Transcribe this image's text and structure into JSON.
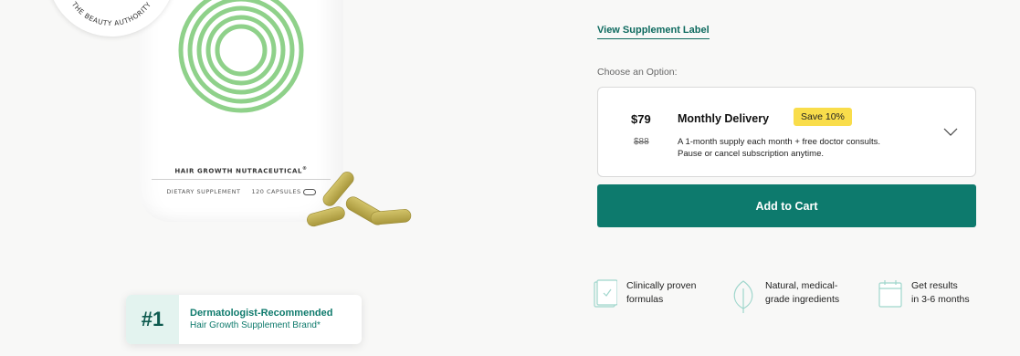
{
  "product": {
    "bottle_name": "HAIR GROWTH NUTRACEUTICAL",
    "bottle_name_mark": "®",
    "bottle_type": "DIETARY SUPPLEMENT",
    "bottle_count": "120 CAPSULES",
    "seal_text": "THE BEAUTY AUTHORITY",
    "ring_color": "#8fd18a",
    "capsule_color": "#bfae4d"
  },
  "badge": {
    "number": "#1",
    "title": "Dermatologist-Recommended",
    "subtitle": "Hair Growth Supplement Brand*"
  },
  "purchase": {
    "supplement_link": "View Supplement Label",
    "option_heading": "Choose an Option:",
    "option": {
      "price": "$79",
      "original_price": "$88",
      "plan": "Monthly Delivery",
      "discount": "Save 10%",
      "description_line1": "A 1-month supply each month + free doctor consults.",
      "description_line2": "Pause or cancel subscription anytime."
    },
    "cart_button": "Add to Cart",
    "accent_color": "#0d7a6d",
    "highlight_color": "#f9dd4b"
  },
  "features": [
    {
      "icon": "checklist-icon",
      "line1": "Clinically proven",
      "line2": "formulas"
    },
    {
      "icon": "leaf-icon",
      "line1": "Natural, medical-",
      "line2": "grade ingredients"
    },
    {
      "icon": "calendar-icon",
      "line1": "Get results",
      "line2": "in 3-6 months"
    }
  ]
}
